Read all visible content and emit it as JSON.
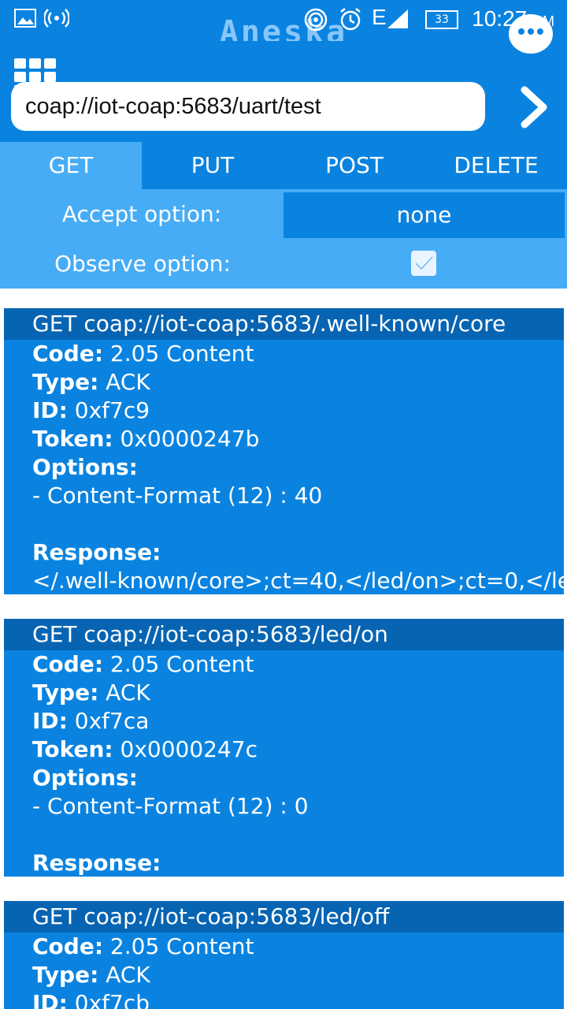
{
  "status_bar": {
    "time": "10:27",
    "ampm": "PM",
    "battery": "33",
    "network": "E",
    "app_title": "Aneska"
  },
  "request": {
    "url": "coap://iot-coap:5683/uart/test"
  },
  "tabs": [
    "GET",
    "PUT",
    "POST",
    "DELETE"
  ],
  "options": {
    "accept_label": "Accept option:",
    "accept_value": "none",
    "observe_label": "Observe option:",
    "observe_checked": true
  },
  "labels": {
    "code": "Code:",
    "type": "Type:",
    "id": "ID:",
    "token": "Token:",
    "options": "Options:",
    "response": "Response:"
  },
  "responses": [
    {
      "header": "GET coap://iot-coap:5683/.well-known/core",
      "code": "2.05 Content",
      "type": "ACK",
      "id": "0xf7c9",
      "token": "0x0000247b",
      "option": "- Content-Format (12) : 40",
      "response": "</.well-known/core>;ct=40,</led/on>;ct=0,</lec"
    },
    {
      "header": "GET coap://iot-coap:5683/led/on",
      "code": "2.05 Content",
      "type": "ACK",
      "id": "0xf7ca",
      "token": "0x0000247c",
      "option": "- Content-Format (12) : 0",
      "response": ""
    },
    {
      "header": "GET coap://iot-coap:5683/led/off",
      "code": "2.05 Content",
      "type": "ACK",
      "id": "0xf7cb"
    }
  ],
  "colors": {
    "primary": "#0a83e0",
    "accent_light": "#47acf6",
    "card_header": "#0764b2"
  }
}
